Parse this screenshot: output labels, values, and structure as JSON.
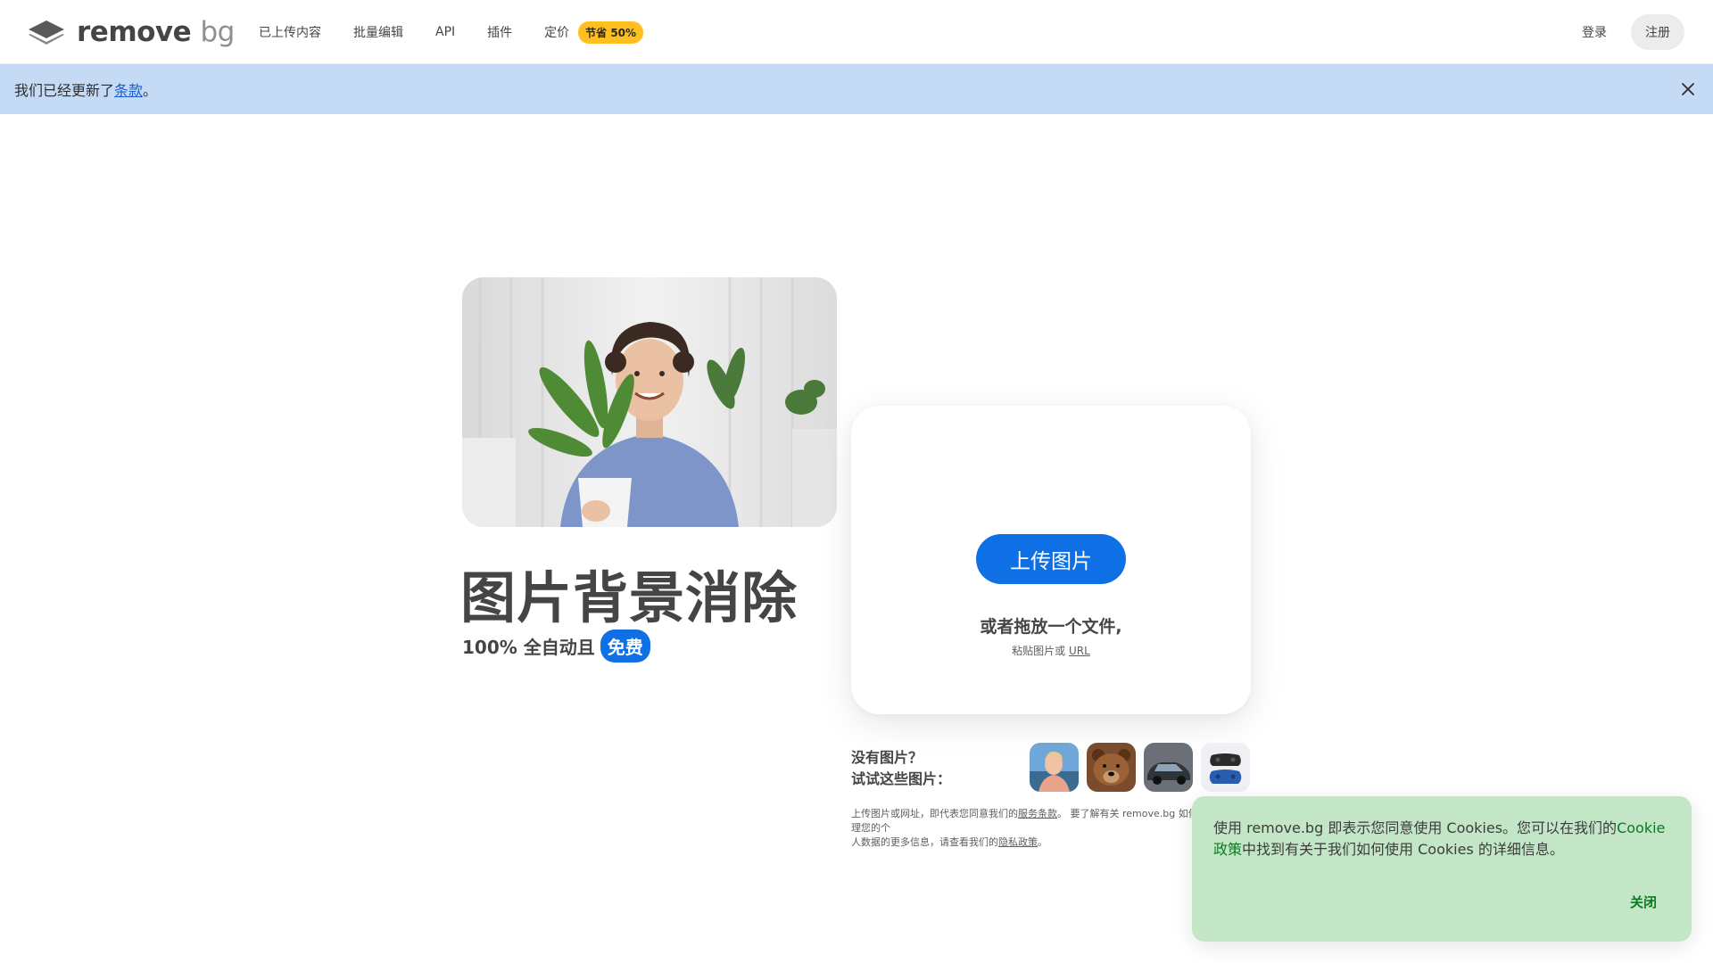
{
  "header": {
    "logo": {
      "name_main": "remove",
      "name_accent": "bg",
      "icon": "stacked-layers-icon"
    },
    "nav": [
      {
        "label": "已上传内容"
      },
      {
        "label": "批量编辑"
      },
      {
        "label": "API"
      },
      {
        "label": "插件"
      },
      {
        "label": "定价",
        "badge": "节省 50%"
      }
    ],
    "login_label": "登录",
    "signup_label": "注册"
  },
  "notice": {
    "prefix": "我们已经更新了",
    "link": "条款",
    "suffix": "。",
    "close_icon": "close-icon"
  },
  "hero": {
    "title": "图片背景消除",
    "subtitle": "100% 全自动且",
    "free_badge": "免费"
  },
  "upload": {
    "button_label": "上传图片",
    "drop_text": "或者拖放一个文件,",
    "paste_prefix": "粘贴图片或 ",
    "paste_link": "URL"
  },
  "samples": {
    "line1": "没有图片？",
    "line2": "试试这些图片：",
    "items": [
      {
        "icon": "person-sample-icon"
      },
      {
        "icon": "bear-sample-icon"
      },
      {
        "icon": "car-sample-icon"
      },
      {
        "icon": "gamepad-sample-icon"
      }
    ]
  },
  "legal": {
    "part1": "上传图片或网址，即代表您同意我们的",
    "terms_link": "服务条款",
    "part2": "。 要了解有关 remove.bg 如何处理您的个",
    "part3": "人数据的更多信息，请查看我们的",
    "privacy_link": "隐私政策",
    "part4": "。"
  },
  "cookie": {
    "text_prefix": "使用 remove.bg 即表示您同意使用 Cookies。您可以在我们的",
    "link": "Cookie政策",
    "text_suffix": "中找到有关于我们如何使用 Cookies 的详细信息。",
    "close_label": "关闭"
  },
  "colors": {
    "brand_blue": "#0f70e6",
    "badge_yellow": "#ffbf1f",
    "notice_bg": "#c5dbf5",
    "cookie_bg": "#c2e6c6",
    "cookie_green": "#0d7a1f"
  }
}
